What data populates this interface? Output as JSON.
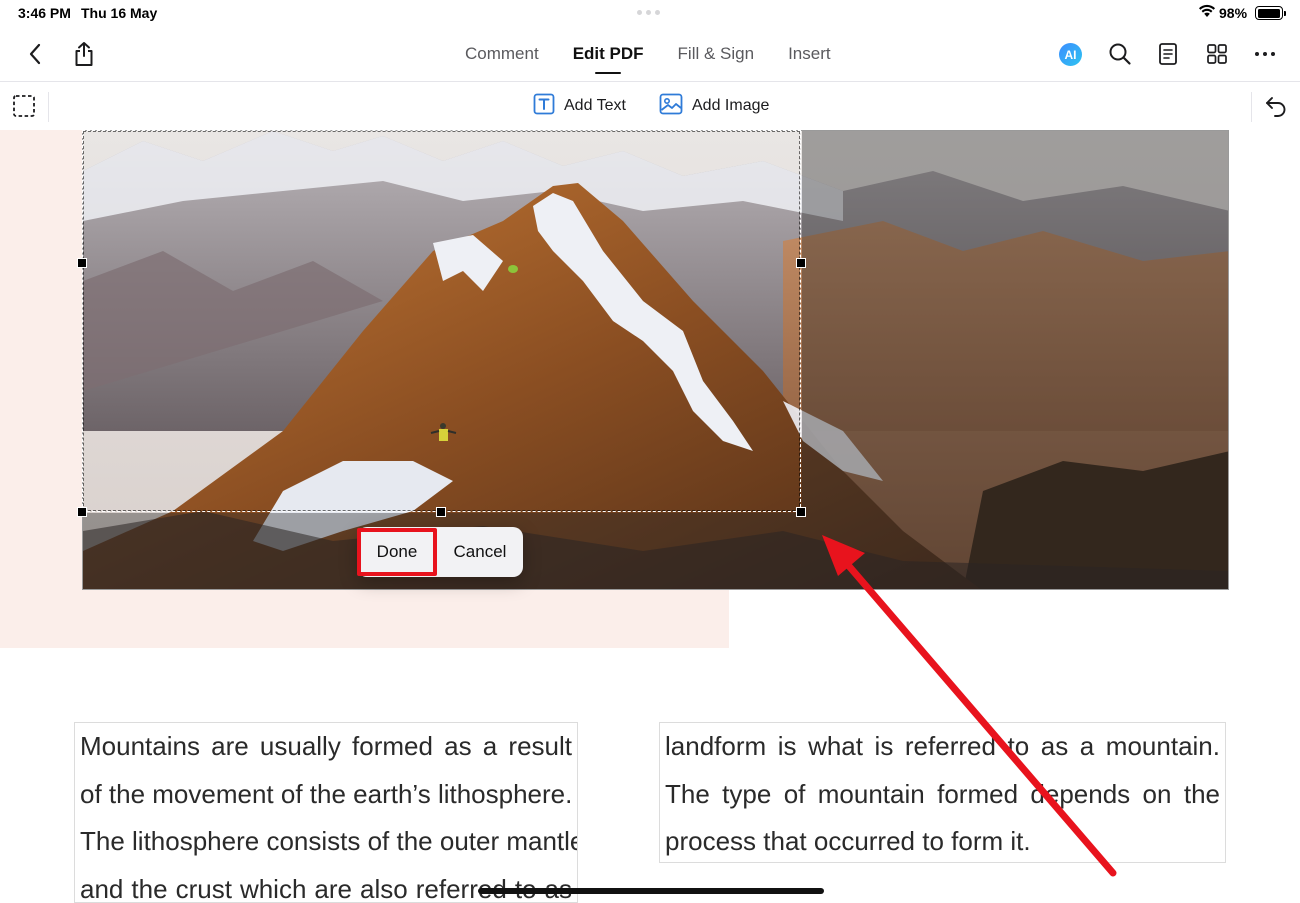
{
  "status_bar": {
    "time": "3:46 PM",
    "date": "Thu 16 May",
    "battery": "98%",
    "battery_level": 0.98
  },
  "nav": {
    "tabs": [
      {
        "label": "Comment",
        "active": false
      },
      {
        "label": "Edit PDF",
        "active": true
      },
      {
        "label": "Fill & Sign",
        "active": false
      },
      {
        "label": "Insert",
        "active": false
      }
    ],
    "ai_label": "AI",
    "icons": [
      "back-icon",
      "share-icon",
      "ai-icon",
      "search-icon",
      "document-icon",
      "grid-icon",
      "more-icon"
    ]
  },
  "edit_toolbar": {
    "add_text": "Add Text",
    "add_image": "Add Image",
    "icons": [
      "selection-icon",
      "text-box-icon",
      "image-icon",
      "undo-icon"
    ]
  },
  "crop_menu": {
    "done": "Done",
    "cancel": "Cancel"
  },
  "document": {
    "left_column": [
      "Mountains are usually formed as a result",
      "of the movement of the earth’s lithosphere.",
      "The lithosphere consists of the outer mantle",
      "and the crust which are also referred to as"
    ],
    "right_column": [
      "landform is what is referred to as a mountain.",
      "The type of mountain formed depends on the",
      "process that occurred to form it."
    ]
  },
  "colors": {
    "accent_highlight": "#e8131d",
    "toolbar_icon": "#2f7bd8",
    "page_tint": "#fbeeea"
  }
}
